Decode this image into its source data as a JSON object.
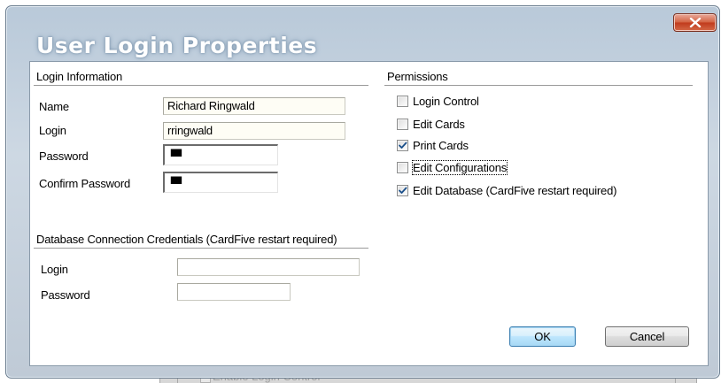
{
  "window": {
    "title": "User Login Properties"
  },
  "login_information": {
    "section_title": "Login Information",
    "name_label": "Name",
    "name_value": "Richard Ringwald",
    "login_label": "Login",
    "login_value": "rringwald",
    "password_label": "Password",
    "password_value": "IIIIIIIII",
    "confirm_password_label": "Confirm Password",
    "confirm_password_value": "IIIIIIIII"
  },
  "database_credentials": {
    "section_title": "Database Connection Credentials (CardFive restart required)",
    "login_label": "Login",
    "login_value": "",
    "password_label": "Password",
    "password_value": ""
  },
  "permissions": {
    "section_title": "Permissions",
    "items": [
      {
        "label": "Login Control",
        "checked": false
      },
      {
        "label": "Edit Cards",
        "checked": false
      },
      {
        "label": "Print Cards",
        "checked": true
      },
      {
        "label": "Edit Configurations",
        "checked": false,
        "focused": true
      },
      {
        "label": "Edit Database (CardFive restart required)",
        "checked": true
      }
    ]
  },
  "buttons": {
    "ok_label": "OK",
    "cancel_label": "Cancel"
  },
  "background_window": {
    "checkbox_label": "Enable Login Control"
  },
  "colors": {
    "checkmark": "#1a4f8a",
    "default_button_border": "#3c7fb1"
  }
}
